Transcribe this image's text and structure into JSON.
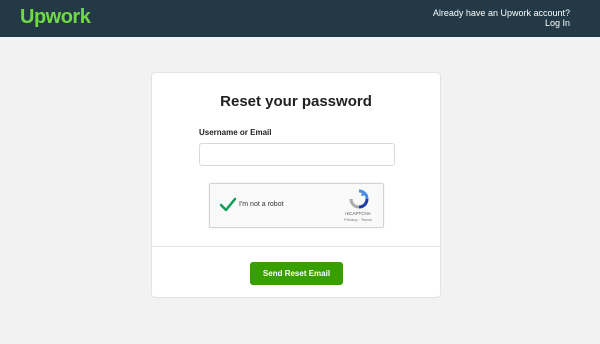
{
  "header": {
    "logo_text": "Upwork",
    "account_prompt": "Already have an Upwork account?",
    "login_label": "Log In",
    "brand_color": "#6fda44",
    "bar_color": "#233a46"
  },
  "form": {
    "title": "Reset your password",
    "field_label": "Username or Email",
    "field_value": "",
    "recaptcha": {
      "label": "I'm not a robot",
      "brand": "reCAPTCHA",
      "links": "Privacy - Terms",
      "checked": true
    },
    "submit_label": "Send Reset Email",
    "submit_color": "#37a000"
  }
}
